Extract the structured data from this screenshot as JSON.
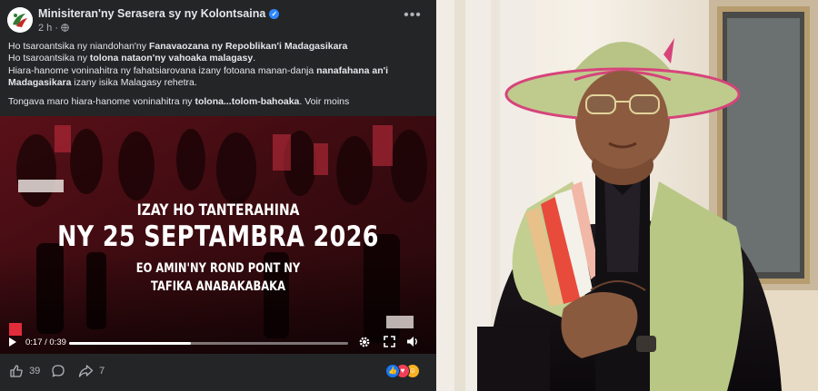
{
  "post": {
    "page_name": "Minisiteran'ny Serasera sy ny Kolontsaina",
    "time": "2 h · ",
    "paragraphs": [
      [
        [
          {
            "t": "Ho tsaroantsika ny niandohan'ny ",
            "b": false
          },
          {
            "t": "Fanavaozana ny Repoblikan'i Madagasikara",
            "b": true
          }
        ],
        [
          {
            "t": "Ho tsaroantsika ny ",
            "b": false
          },
          {
            "t": "tolona nataon'ny vahoaka malagasy",
            "b": true
          },
          {
            "t": ".",
            "b": false
          }
        ],
        [
          {
            "t": "Hiara-hanome voninahitra ny fahatsiarovana izany fotoana manan-danja ",
            "b": false
          },
          {
            "t": "nanafahana an'i",
            "b": true
          }
        ],
        [
          {
            "t": "Madagasikara",
            "b": true
          },
          {
            "t": " izany isika Malagasy rehetra.",
            "b": false
          }
        ]
      ],
      [
        [
          {
            "t": "Tongava maro hiara-hanome voninahitra ny ",
            "b": false
          },
          {
            "t": "tolona...tolom-bahoaka",
            "b": true
          },
          {
            "t": ". ",
            "b": false
          },
          {
            "t": "Voir moins",
            "b": false,
            "link": true
          }
        ]
      ]
    ]
  },
  "video": {
    "overlay_line1": "IZAY HO TANTERAHINA",
    "overlay_line2": "NY 25 SEPTAMBRA 2026",
    "overlay_line3": "EO AMIN'NY ROND PONT NY",
    "overlay_line4": "TAFIKA ANABAKABAKA",
    "current_time": "0:17",
    "duration": "0:39",
    "progress": 0.436
  },
  "actions": {
    "like_count": "39",
    "share_count": "7",
    "reaction_icons": [
      "like-icon",
      "love-icon",
      "care-icon"
    ]
  },
  "colors": {
    "post_bg": "#242526",
    "text": "#e4e6eb",
    "muted": "#b0b3b8",
    "verified": "#2d88ff",
    "video_red": "#8b1a22"
  }
}
